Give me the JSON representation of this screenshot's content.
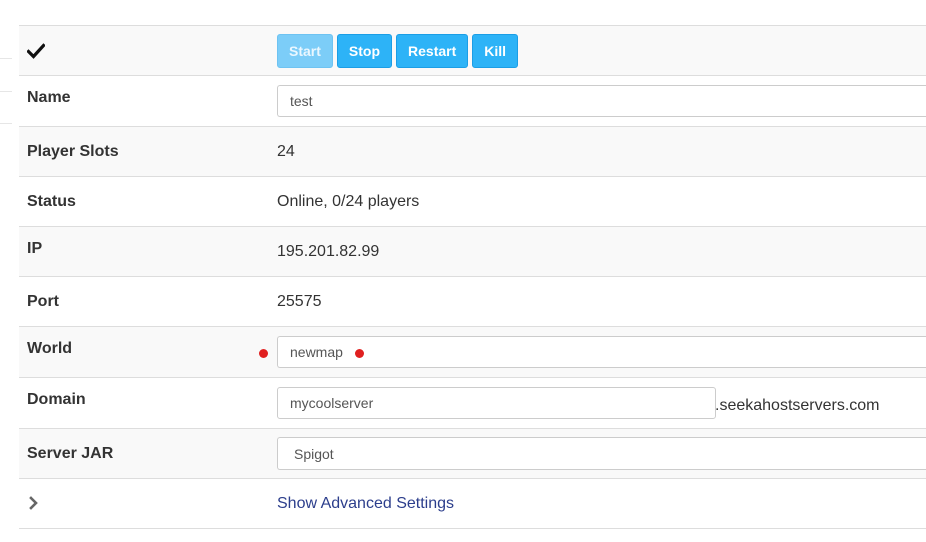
{
  "actions": {
    "status_icon": "check-icon",
    "buttons": [
      {
        "label": "Start",
        "disabled": true
      },
      {
        "label": "Stop",
        "disabled": false
      },
      {
        "label": "Restart",
        "disabled": false
      },
      {
        "label": "Kill",
        "disabled": false
      }
    ]
  },
  "fields": {
    "name": {
      "label": "Name",
      "value": "test"
    },
    "player_slots": {
      "label": "Player Slots",
      "value": "24"
    },
    "status": {
      "label": "Status",
      "value": "Online, 0/24 players"
    },
    "ip": {
      "label": "IP",
      "value": "195.201.82.99"
    },
    "port": {
      "label": "Port",
      "value": "25575"
    },
    "world": {
      "label": "World",
      "value": "newmap"
    },
    "domain": {
      "label": "Domain",
      "value": "mycoolserver",
      "suffix": ".seekahostservers.com"
    },
    "server_jar": {
      "label": "Server JAR",
      "value": "Spigot"
    }
  },
  "advanced": {
    "icon": "chevron-right-icon",
    "label": "Show Advanced Settings"
  },
  "colors": {
    "button": "#2db3f7",
    "button_disabled": "#7ccdf8",
    "marker": "#e02020",
    "link": "#2c3e8c"
  }
}
